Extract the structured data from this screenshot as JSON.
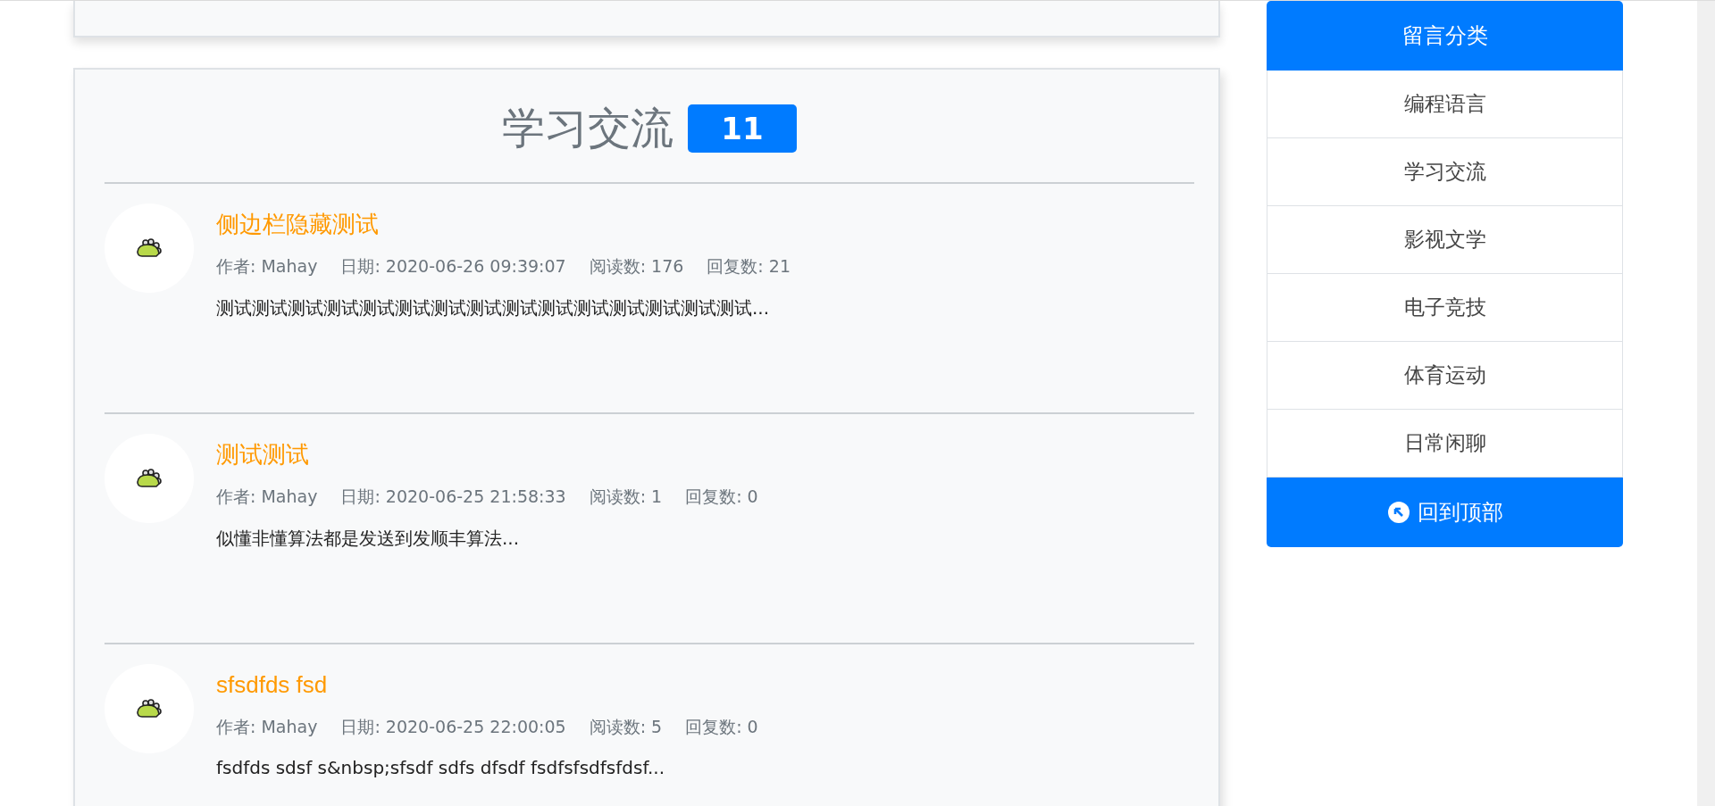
{
  "section": {
    "title": "学习交流",
    "count": "11"
  },
  "posts": [
    {
      "title": "侧边栏隐藏测试",
      "author": "作者: Mahay",
      "date": "日期: 2020-06-26 09:39:07",
      "reads": "阅读数: 176",
      "replies": "回复数: 21",
      "excerpt": "测试测试测试测试测试测试测试测试测试测试测试测试测试测试测试..."
    },
    {
      "title": "测试测试",
      "author": "作者: Mahay",
      "date": "日期: 2020-06-25 21:58:33",
      "reads": "阅读数: 1",
      "replies": "回复数: 0",
      "excerpt": "似懂非懂算法都是发送到发顺丰算法..."
    },
    {
      "title": "sfsdfds fsd",
      "author": "作者: Mahay",
      "date": "日期: 2020-06-25 22:00:05",
      "reads": "阅读数: 5",
      "replies": "回复数: 0",
      "excerpt": "fsdfds sdsf s&nbsp;sfsdf sdfs dfsdf fsdfsfsdfsfdsf..."
    }
  ],
  "sidebar": {
    "title": "留言分类",
    "items": [
      {
        "label": "编程语言",
        "selected": false
      },
      {
        "label": "学习交流",
        "selected": false
      },
      {
        "label": "影视文学",
        "selected": false
      },
      {
        "label": "电子竞技",
        "selected": false
      },
      {
        "label": "体育运动",
        "selected": false
      },
      {
        "label": "日常闲聊",
        "selected": false
      }
    ],
    "back_to_top": "回到顶部"
  }
}
